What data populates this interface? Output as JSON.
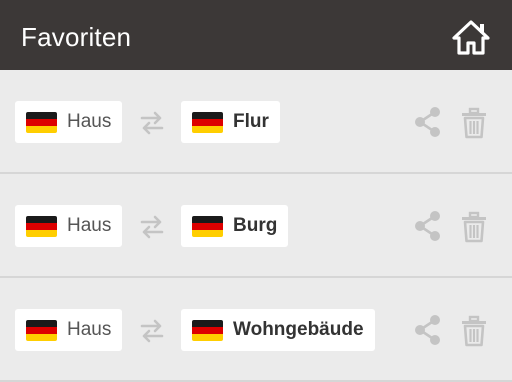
{
  "appbar": {
    "title": "Favoriten",
    "home_icon": "home-icon"
  },
  "colors": {
    "appbar_bg": "#3c3837",
    "page_bg": "#ebebeb",
    "icon_gray": "#c4c4c4",
    "flag_black": "#1a1a1a",
    "flag_red": "#dd0000",
    "flag_gold": "#ffce00"
  },
  "favorites": [
    {
      "source_word": "Haus",
      "source_flag": "german-flag-icon",
      "target_word": "Flur",
      "target_flag": "german-flag-icon"
    },
    {
      "source_word": "Haus",
      "source_flag": "german-flag-icon",
      "target_word": "Burg",
      "target_flag": "german-flag-icon"
    },
    {
      "source_word": "Haus",
      "source_flag": "german-flag-icon",
      "target_word": "Wohngebäude",
      "target_flag": "german-flag-icon"
    }
  ],
  "row_icons": {
    "swap": "swap-arrows-icon",
    "share": "share-icon",
    "delete": "trash-icon"
  }
}
